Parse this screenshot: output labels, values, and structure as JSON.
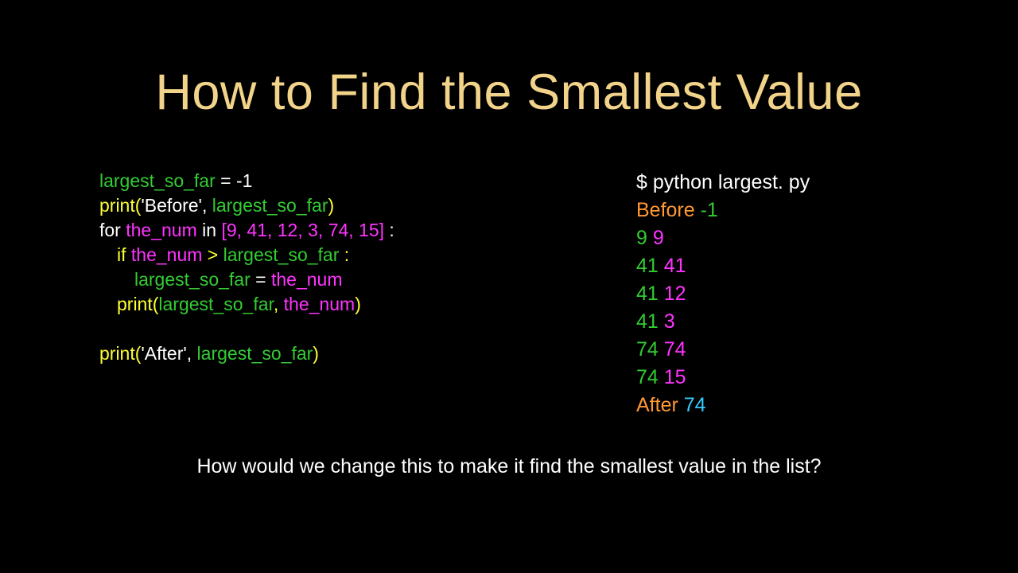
{
  "title": "How to Find the Smallest Value",
  "code": {
    "l1": {
      "a": "largest_so_far",
      "b": " = -1"
    },
    "l2": {
      "a": "print(",
      "b": "'Before'",
      "c": ", ",
      "d": "largest_so_far",
      "e": ")"
    },
    "l3": {
      "a": "for ",
      "b": "the_num",
      "c": " in ",
      "d": "[9, 41, 12, 3, 74, 15]",
      "e": " :"
    },
    "l4": {
      "a": "if ",
      "b": "the_num",
      "c": " > ",
      "d": "largest_so_far",
      "e": " :"
    },
    "l5": {
      "a": "largest_so_far",
      "b": " = ",
      "c": "the_num"
    },
    "l6": {
      "a": "print(",
      "b": "largest_so_far",
      "c": ", ",
      "d": "the_num",
      "e": ")"
    },
    "l7": {
      "a": "print(",
      "b": "'After'",
      "c": ", ",
      "d": "largest_so_far",
      "e": ")"
    }
  },
  "output": {
    "cmd": "$ python largest. py",
    "before": {
      "a": "Before ",
      "b": "-1"
    },
    "rows": [
      {
        "a": "9",
        "b": "  9"
      },
      {
        "a": "41",
        "b": "  41"
      },
      {
        "a": "41",
        "b": " 12"
      },
      {
        "a": "41",
        "b": "  3"
      },
      {
        "a": "74",
        "b": "  74"
      },
      {
        "a": "74",
        "b": "  15"
      }
    ],
    "after": {
      "a": "After ",
      "b": "74"
    }
  },
  "footer": "How would we change this to make it find the smallest value in the list?"
}
